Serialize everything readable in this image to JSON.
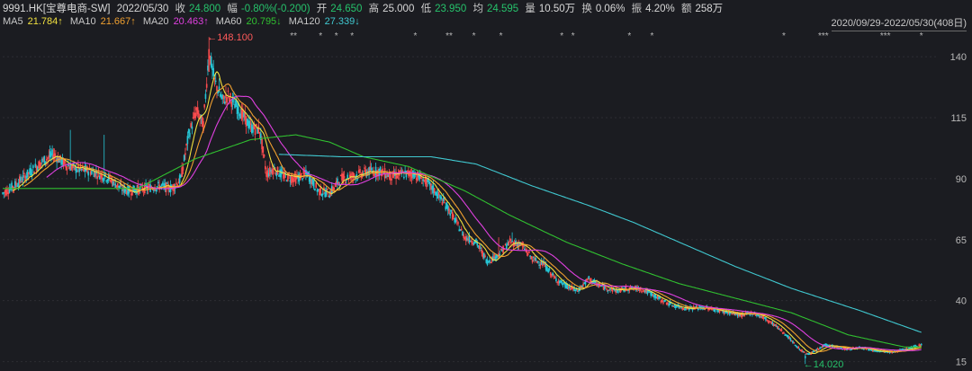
{
  "header": {
    "stock": "9991.HK[宝尊电商-SW]",
    "date": "2022/05/30",
    "close_label": "收",
    "close": "24.800",
    "change_label": "幅",
    "change": "-0.80%(-0.200)",
    "open_label": "开",
    "open": "24.650",
    "high_label": "高",
    "high": "25.000",
    "low_label": "低",
    "low": "23.950",
    "avg_label": "均",
    "avg": "24.595",
    "vol_label": "量",
    "vol": "10.50万",
    "turnover_label": "换",
    "turnover": "0.06%",
    "amplitude_label": "振",
    "amplitude": "4.20%",
    "amount_label": "额",
    "amount": "258万"
  },
  "ma_legend": [
    {
      "label": "MA5",
      "value": "21.784↑",
      "color": "#f0e040"
    },
    {
      "label": "MA10",
      "value": "21.667↑",
      "color": "#f0a030"
    },
    {
      "label": "MA20",
      "value": "20.463↑",
      "color": "#e040e0"
    },
    {
      "label": "MA60",
      "value": "20.795↓",
      "color": "#30c030"
    },
    {
      "label": "MA120",
      "value": "27.339↓",
      "color": "#40c8d0"
    }
  ],
  "date_range": "2020/09/29-2022/05/30(408日)",
  "colors": {
    "background": "#1b1c21",
    "up": "#ff4d4f",
    "down": "#26c6d6",
    "grid": "#2c2d33",
    "text": "#c8c8c8"
  },
  "chart_data": {
    "type": "candlestick",
    "ylim": [
      13,
      150
    ],
    "y_ticks": [
      140,
      115,
      90,
      65,
      40,
      15
    ],
    "high_marker": "148.100",
    "low_marker": "14.020",
    "anchors": [
      [
        0,
        84
      ],
      [
        10,
        87
      ],
      [
        20,
        91
      ],
      [
        35,
        97
      ],
      [
        45,
        100
      ],
      [
        55,
        96
      ],
      [
        65,
        94
      ],
      [
        80,
        93
      ],
      [
        95,
        90
      ],
      [
        105,
        86
      ],
      [
        112,
        85
      ],
      [
        125,
        86
      ],
      [
        140,
        87
      ],
      [
        150,
        86
      ],
      [
        158,
        90
      ],
      [
        165,
        108
      ],
      [
        172,
        118
      ],
      [
        178,
        112
      ],
      [
        183,
        142
      ],
      [
        188,
        130
      ],
      [
        195,
        122
      ],
      [
        200,
        124
      ],
      [
        210,
        118
      ],
      [
        220,
        111
      ],
      [
        228,
        110
      ],
      [
        234,
        92
      ],
      [
        240,
        94
      ],
      [
        250,
        91
      ],
      [
        260,
        90
      ],
      [
        270,
        92
      ],
      [
        280,
        85
      ],
      [
        290,
        84
      ],
      [
        300,
        90
      ],
      [
        310,
        91
      ],
      [
        325,
        93
      ],
      [
        335,
        93
      ],
      [
        345,
        91
      ],
      [
        355,
        92
      ],
      [
        365,
        92
      ],
      [
        375,
        89
      ],
      [
        385,
        84
      ],
      [
        395,
        78
      ],
      [
        405,
        70
      ],
      [
        410,
        66
      ],
      [
        420,
        64
      ],
      [
        430,
        56
      ],
      [
        440,
        59
      ],
      [
        450,
        64
      ],
      [
        460,
        63
      ],
      [
        470,
        57
      ],
      [
        480,
        55
      ],
      [
        490,
        49
      ],
      [
        500,
        46
      ],
      [
        510,
        44
      ],
      [
        520,
        49
      ],
      [
        530,
        46
      ],
      [
        545,
        44
      ],
      [
        555,
        45
      ],
      [
        565,
        45
      ],
      [
        575,
        43
      ],
      [
        585,
        40
      ],
      [
        595,
        38
      ],
      [
        605,
        37
      ],
      [
        615,
        37
      ],
      [
        625,
        37
      ],
      [
        635,
        36
      ],
      [
        645,
        35
      ],
      [
        655,
        34
      ],
      [
        665,
        35
      ],
      [
        675,
        33
      ],
      [
        685,
        30
      ],
      [
        695,
        26
      ],
      [
        705,
        21
      ],
      [
        713,
        18
      ],
      [
        720,
        19
      ],
      [
        730,
        22
      ],
      [
        740,
        21
      ],
      [
        750,
        20
      ],
      [
        760,
        21
      ],
      [
        770,
        20
      ],
      [
        780,
        19
      ],
      [
        790,
        19
      ],
      [
        800,
        20
      ],
      [
        808,
        21
      ],
      [
        815,
        22
      ]
    ],
    "ma_overrides": {
      "ma60": [
        [
          0,
          86
        ],
        [
          120,
          86
        ],
        [
          170,
          98
        ],
        [
          220,
          106
        ],
        [
          260,
          108
        ],
        [
          290,
          105
        ],
        [
          320,
          99
        ],
        [
          360,
          95
        ],
        [
          410,
          85
        ],
        [
          450,
          75
        ],
        [
          500,
          64
        ],
        [
          550,
          55
        ],
        [
          600,
          47
        ],
        [
          650,
          41
        ],
        [
          700,
          35
        ],
        [
          750,
          26
        ],
        [
          800,
          21
        ],
        [
          815,
          21
        ]
      ],
      "ma120": [
        [
          245,
          100
        ],
        [
          300,
          99
        ],
        [
          350,
          99
        ],
        [
          380,
          99
        ],
        [
          420,
          96
        ],
        [
          470,
          87
        ],
        [
          520,
          79
        ],
        [
          560,
          72
        ],
        [
          600,
          64
        ],
        [
          650,
          54
        ],
        [
          700,
          45
        ],
        [
          760,
          36
        ],
        [
          815,
          27
        ]
      ]
    },
    "markers_top": [
      [
        "**",
        258
      ],
      [
        "*",
        282
      ],
      [
        "*",
        296
      ],
      [
        "*",
        310
      ],
      [
        "*",
        366
      ],
      [
        "**",
        396
      ],
      [
        "*",
        418
      ],
      [
        "*",
        442
      ],
      [
        "*",
        496
      ],
      [
        "*",
        506
      ],
      [
        "*",
        556
      ],
      [
        "*",
        576
      ],
      [
        "*",
        693
      ],
      [
        "***",
        728
      ],
      [
        "***",
        783
      ],
      [
        "*",
        815
      ]
    ]
  }
}
